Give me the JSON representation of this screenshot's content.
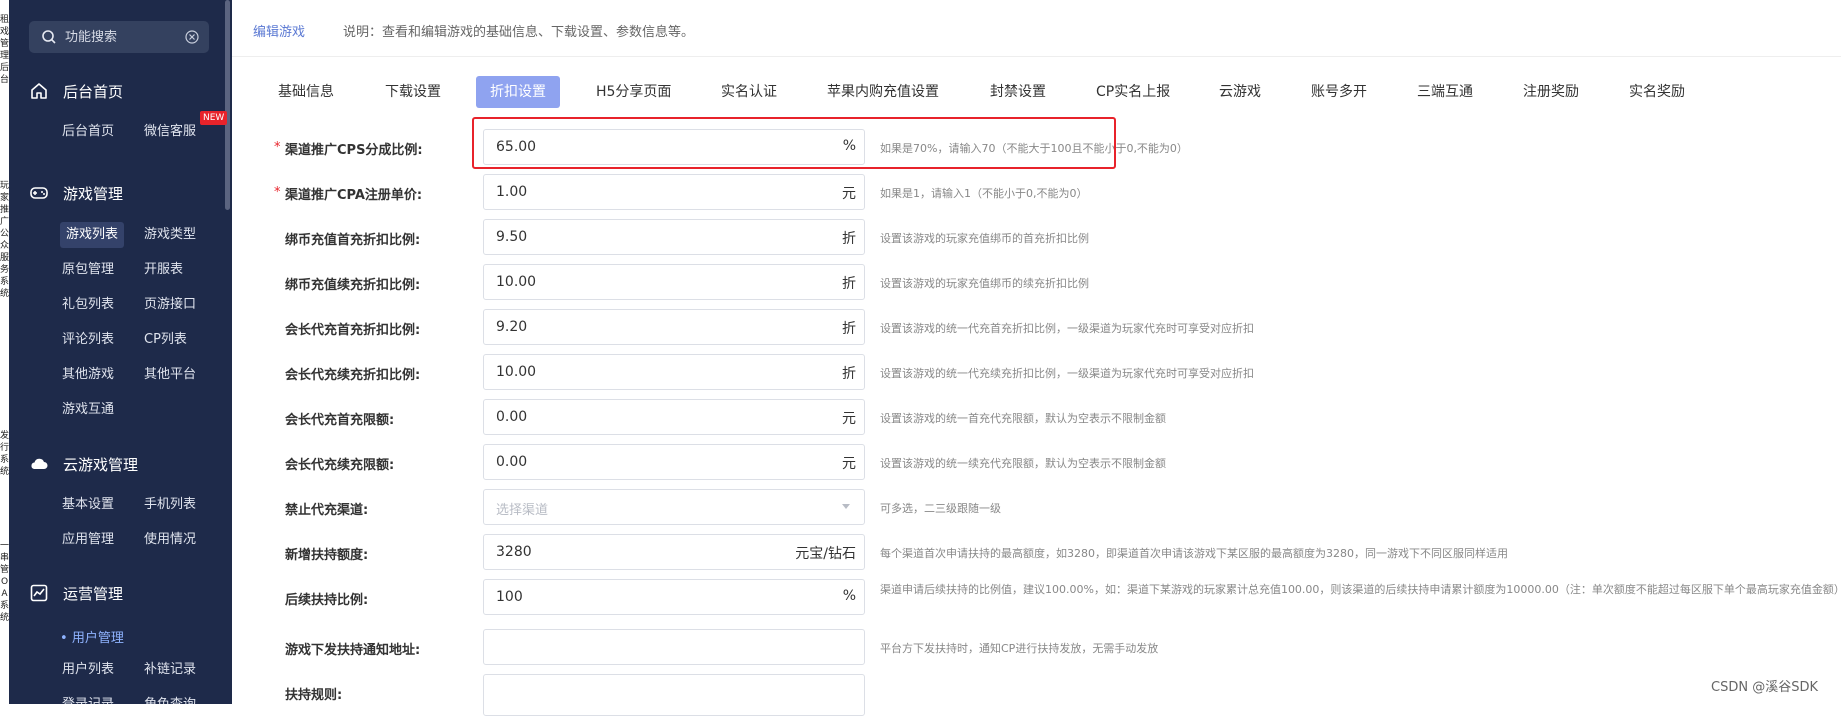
{
  "left_strip": {
    "groups": [
      {
        "chars": [
          "租",
          "戏",
          "管",
          "理",
          "后",
          "台"
        ]
      },
      {
        "chars": [
          "玩",
          "家",
          "推",
          "广",
          "公",
          "众",
          "服",
          "务",
          "系",
          "统"
        ]
      },
      {
        "chars": [
          "发",
          "行",
          "系",
          "统"
        ]
      },
      {
        "chars": [
          "一",
          "串",
          "管",
          "O",
          "A",
          "系",
          "统"
        ]
      }
    ]
  },
  "sidebar": {
    "search": {
      "placeholder": "功能搜索",
      "icon": "search-icon",
      "clear_icon": "close-circle-icon"
    },
    "new_badge": "NEW",
    "sections": [
      {
        "icon": "home-icon",
        "label": "后台首页",
        "items": [
          "后台首页",
          "微信客服"
        ]
      },
      {
        "icon": "gamepad-icon",
        "label": "游戏管理",
        "items": [
          "游戏列表",
          "游戏类型",
          "原包管理",
          "开服表",
          "礼包列表",
          "页游接口",
          "评论列表",
          "CP列表",
          "其他游戏",
          "其他平台",
          "游戏互通"
        ]
      },
      {
        "icon": "cloud-icon",
        "label": "云游戏管理",
        "items": [
          "基本设置",
          "手机列表",
          "应用管理",
          "使用情况"
        ]
      },
      {
        "icon": "chart-icon",
        "label": "运营管理",
        "bullet_item": "用户管理",
        "items": [
          "用户列表",
          "补链记录",
          "登录记录",
          "角色查询"
        ]
      }
    ],
    "active_item": "游戏列表"
  },
  "header": {
    "title": "编辑游戏",
    "description": "说明：查看和编辑游戏的基础信息、下载设置、参数信息等。"
  },
  "tabs": [
    {
      "label": "基础信息"
    },
    {
      "label": "下载设置"
    },
    {
      "label": "折扣设置",
      "active": true
    },
    {
      "label": "H5分享页面"
    },
    {
      "label": "实名认证"
    },
    {
      "label": "苹果内购充值设置"
    },
    {
      "label": "封禁设置"
    },
    {
      "label": "CP实名上报"
    },
    {
      "label": "云游戏"
    },
    {
      "label": "账号多开"
    },
    {
      "label": "三端互通"
    },
    {
      "label": "注册奖励"
    },
    {
      "label": "实名奖励"
    }
  ],
  "form": [
    {
      "label": "渠道推广CPS分成比例:",
      "required": true,
      "value": "65.00",
      "unit": "%",
      "hint": "如果是70%，请输入70（不能大于100且不能小于0,不能为0）"
    },
    {
      "label": "渠道推广CPA注册单价:",
      "required": true,
      "value": "1.00",
      "unit": "元",
      "hint": "如果是1，请输入1（不能小于0,不能为0）"
    },
    {
      "label": "绑币充值首充折扣比例:",
      "value": "9.50",
      "unit": "折",
      "hint": "设置该游戏的玩家充值绑币的首充折扣比例"
    },
    {
      "label": "绑币充值续充折扣比例:",
      "value": "10.00",
      "unit": "折",
      "hint": "设置该游戏的玩家充值绑币的续充折扣比例"
    },
    {
      "label": "会长代充首充折扣比例:",
      "value": "9.20",
      "unit": "折",
      "hint": "设置该游戏的统一代充首充折扣比例，一级渠道为玩家代充时可享受对应折扣"
    },
    {
      "label": "会长代充续充折扣比例:",
      "value": "10.00",
      "unit": "折",
      "hint": "设置该游戏的统一代充续充折扣比例，一级渠道为玩家代充时可享受对应折扣"
    },
    {
      "label": "会长代充首充限额:",
      "value": "0.00",
      "unit": "元",
      "hint": "设置该游戏的统一首充代充限额，默认为空表示不限制金额"
    },
    {
      "label": "会长代充续充限额:",
      "value": "0.00",
      "unit": "元",
      "hint": "设置该游戏的统一续充代充限额，默认为空表示不限制金额"
    },
    {
      "label": "禁止代充渠道:",
      "placeholder": "选择渠道",
      "select": true,
      "hint": "可多选，二三级跟随一级"
    },
    {
      "label": "新增扶持额度:",
      "value": "3280",
      "unit": "元宝/钻石",
      "hint": "每个渠道首次申请扶持的最高额度，如3280，即渠道首次申请该游戏下某区服的最高额度为3280，同一游戏下不同区服同样适用"
    },
    {
      "label": "后续扶持比例:",
      "value": "100",
      "unit": "%",
      "hint": "渠道申请后续扶持的比例值，建议100.00%，如：渠道下某游戏的玩家累计总充值100.00，则该渠道的后续扶持申请累计额度为10000.00（注：单次额度不能超过每区服下单个最高玩家充值金额）"
    },
    {
      "label": "游戏下发扶持通知地址:",
      "value": "",
      "hint": "平台方下发扶持时，通知CP进行扶持发放，无需手动发放"
    },
    {
      "label": "扶持规则:",
      "value": "",
      "hint": ""
    }
  ],
  "watermark": "CSDN @溪谷SDK",
  "colors": {
    "sidebar_bg": "#1e2a4a",
    "tab_active": "#8fa3f0",
    "title_blue": "#5b79d3",
    "required_red": "#e8232b"
  }
}
